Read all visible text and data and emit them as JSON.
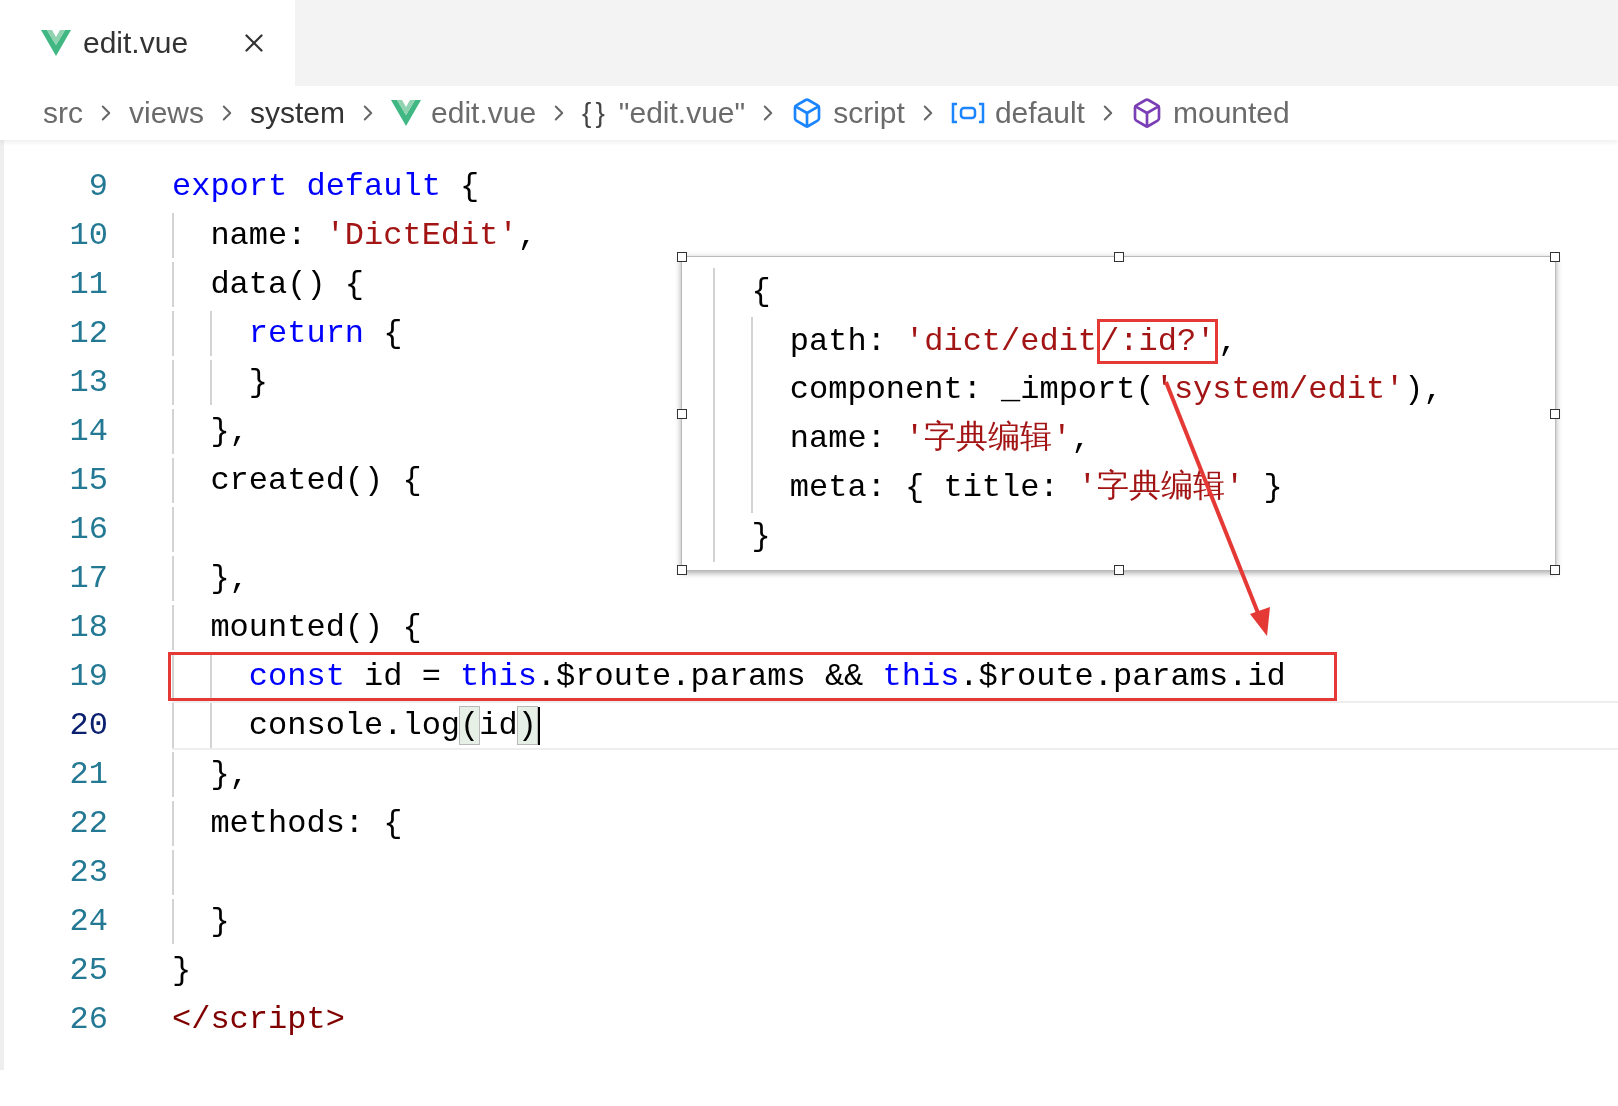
{
  "tabs": [
    {
      "label": "edit.vue",
      "selected": true
    }
  ],
  "breadcrumb": [
    {
      "label": "src",
      "kind": "folder",
      "selected": false
    },
    {
      "label": "views",
      "kind": "folder",
      "selected": false
    },
    {
      "label": "system",
      "kind": "folder",
      "selected": true
    },
    {
      "label": "edit.vue",
      "kind": "vue",
      "selected": false
    },
    {
      "label": "\"edit.vue\"",
      "kind": "object",
      "icon_text": "{}",
      "selected": false
    },
    {
      "label": "script",
      "kind": "module",
      "selected": false
    },
    {
      "label": "default",
      "kind": "field",
      "selected": false
    },
    {
      "label": "mounted",
      "kind": "method",
      "selected": false
    }
  ],
  "code": {
    "lines": [
      {
        "number": "9",
        "tokens": [
          {
            "text": "export",
            "kind": "keyword"
          },
          {
            "text": " default",
            "kind": "keyword"
          },
          {
            "text": " {",
            "kind": "plain"
          }
        ]
      },
      {
        "number": "10",
        "tokens": [
          {
            "text": "  name: ",
            "kind": "plain"
          },
          {
            "text": "'DictEdit'",
            "kind": "string"
          },
          {
            "text": ",",
            "kind": "plain"
          }
        ]
      },
      {
        "number": "11",
        "tokens": [
          {
            "text": "  data() {",
            "kind": "plain"
          }
        ]
      },
      {
        "number": "12",
        "tokens": [
          {
            "text": "    return",
            "kind": "keyword"
          },
          {
            "text": " {",
            "kind": "plain"
          }
        ]
      },
      {
        "number": "13",
        "tokens": [
          {
            "text": "    }",
            "kind": "plain"
          }
        ]
      },
      {
        "number": "14",
        "tokens": [
          {
            "text": "  },",
            "kind": "plain"
          }
        ]
      },
      {
        "number": "15",
        "tokens": [
          {
            "text": "  created() {",
            "kind": "plain"
          }
        ]
      },
      {
        "number": "16"
      },
      {
        "number": "17",
        "tokens": [
          {
            "text": "  },",
            "kind": "plain"
          }
        ]
      },
      {
        "number": "18",
        "tokens": [
          {
            "text": "  mounted() {",
            "kind": "plain"
          }
        ]
      },
      {
        "number": "19",
        "boxed": true,
        "tokens": [
          {
            "text": "    const",
            "kind": "keyword"
          },
          {
            "text": " id = ",
            "kind": "plain"
          },
          {
            "text": "this",
            "kind": "keyword"
          },
          {
            "text": ".$route.params && ",
            "kind": "plain"
          },
          {
            "text": "this",
            "kind": "keyword"
          },
          {
            "text": ".$route.params.id",
            "kind": "plain"
          }
        ]
      },
      {
        "number": "20",
        "current": true,
        "cursor": true,
        "tokens": [
          {
            "text": "    console.log",
            "kind": "plain"
          },
          {
            "text": "(",
            "kind": "match"
          },
          {
            "text": "id",
            "kind": "plain"
          },
          {
            "text": ")",
            "kind": "match"
          }
        ]
      },
      {
        "number": "21",
        "tokens": [
          {
            "text": "  },",
            "kind": "plain"
          }
        ]
      },
      {
        "number": "22",
        "tokens": [
          {
            "text": "  methods: {",
            "kind": "plain"
          }
        ]
      },
      {
        "number": "23"
      },
      {
        "number": "24",
        "tokens": [
          {
            "text": "  }",
            "kind": "plain"
          }
        ]
      },
      {
        "number": "25",
        "tokens": [
          {
            "text": "}",
            "kind": "plain"
          }
        ]
      },
      {
        "number": "26",
        "tokens": [
          {
            "text": "</script>",
            "kind": "tag"
          }
        ]
      }
    ]
  },
  "pasted_image": {
    "lines": [
      {
        "tokens": [
          {
            "text": "  {",
            "kind": "plain"
          }
        ]
      },
      {
        "tokens": [
          {
            "text": "    path: ",
            "kind": "plain"
          },
          {
            "text": "'dict/edit",
            "kind": "string"
          },
          {
            "text": "/:id?'",
            "kind": "string",
            "boxed": true
          },
          {
            "text": ",",
            "kind": "plain"
          }
        ]
      },
      {
        "tokens": [
          {
            "text": "    component: _import(",
            "kind": "plain"
          },
          {
            "text": "'system/edit'",
            "kind": "string"
          },
          {
            "text": "),",
            "kind": "plain"
          }
        ]
      },
      {
        "tokens": [
          {
            "text": "    name: ",
            "kind": "plain"
          },
          {
            "text": "'字典编辑'",
            "kind": "string"
          },
          {
            "text": ",",
            "kind": "plain"
          }
        ]
      },
      {
        "tokens": [
          {
            "text": "    meta: { title: ",
            "kind": "plain"
          },
          {
            "text": "'字典编辑'",
            "kind": "string"
          },
          {
            "text": " }",
            "kind": "plain"
          }
        ]
      },
      {
        "tokens": [
          {
            "text": "  }",
            "kind": "plain"
          }
        ]
      }
    ]
  }
}
